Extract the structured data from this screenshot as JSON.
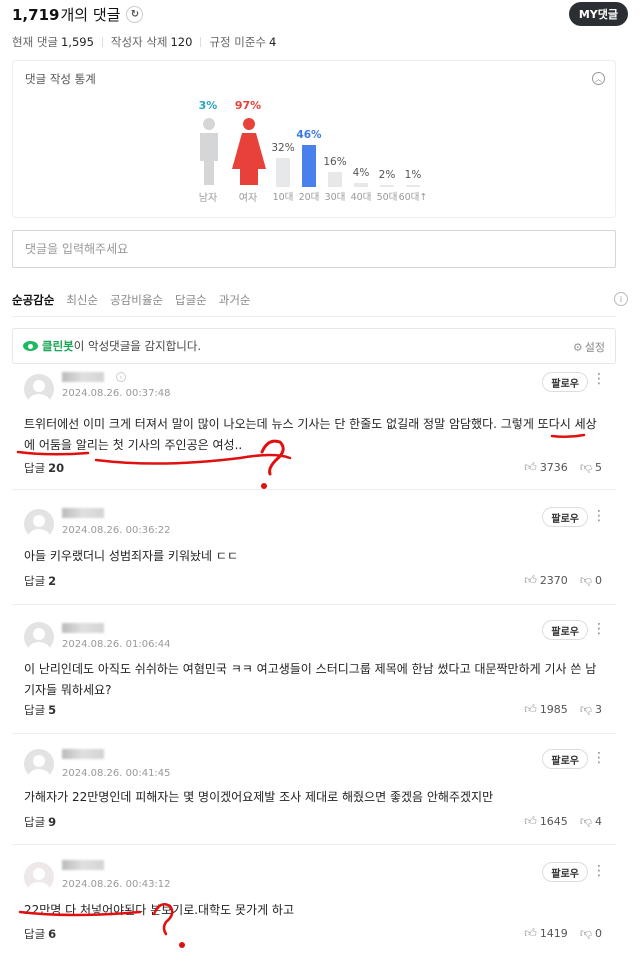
{
  "header": {
    "total_count": "1,719",
    "total_suffix": "개의 댓글",
    "my_comments_label": "MY댓글",
    "current_label": "현재 댓글",
    "current_value": "1,595",
    "deleted_label": "작성자 삭제",
    "deleted_value": "120",
    "violation_label": "규정 미준수",
    "violation_value": "4"
  },
  "stats": {
    "title": "댓글 작성 통계",
    "gender": [
      {
        "label": "남자",
        "percent": "3%",
        "value": 3,
        "color": "#2ba5bc"
      },
      {
        "label": "여자",
        "percent": "97%",
        "value": 97,
        "color": "#e8413a"
      }
    ],
    "age": [
      {
        "label": "10대",
        "percent": "32%",
        "value": 32
      },
      {
        "label": "20대",
        "percent": "46%",
        "value": 46
      },
      {
        "label": "30대",
        "percent": "16%",
        "value": 16
      },
      {
        "label": "40대",
        "percent": "4%",
        "value": 4
      },
      {
        "label": "50대",
        "percent": "2%",
        "value": 2
      },
      {
        "label": "60대↑",
        "percent": "1%",
        "value": 1
      }
    ]
  },
  "input": {
    "placeholder": "댓글을 입력해주세요"
  },
  "sort_tabs": [
    "순공감순",
    "최신순",
    "공감비율순",
    "답글순",
    "과거순"
  ],
  "cleanbot": {
    "name": "클린봇",
    "message": "이 악성댓글을 감지합니다.",
    "setting_label": "설정"
  },
  "comment_labels": {
    "follow": "팔로우",
    "reply": "답글"
  },
  "comments": [
    {
      "date": "2024.08.26. 00:37:48",
      "text": "트위터에선 이미 크게 터져서 말이 많이 나오는데 뉴스 기사는 단 한줄도 없길래 정말 암담했다. 그렇게 또다시 세상에 어둠을 알리는 첫 기사의 주인공은 여성..",
      "replies": "20",
      "likes": "3736",
      "dislikes": "5"
    },
    {
      "date": "2024.08.26. 00:36:22",
      "text": "아들 키우랬더니 성범죄자를 키워놨네 ㄷㄷ",
      "replies": "2",
      "likes": "2370",
      "dislikes": "0"
    },
    {
      "date": "2024.08.26. 01:06:44",
      "text": "이 난리인데도 아직도 쉬쉬하는 여혐민국 ㅋㅋ 여고생들이 스터디그룹 제목에 한남 썼다고 대문짝만하게 기사 쓴 남기자들 뭐하세요?",
      "replies": "5",
      "likes": "1985",
      "dislikes": "3"
    },
    {
      "date": "2024.08.26. 00:41:45",
      "text": "가해자가 22만명인데 피해자는 몇 명이겠어요제발 조사 제대로 해줬으면 좋겠음 안해주겠지만",
      "replies": "9",
      "likes": "1645",
      "dislikes": "4"
    },
    {
      "date": "2024.08.26. 00:43:12",
      "text": "22만명 다 처넣어야된다 본보기로.대학도 못가게 하고",
      "replies": "6",
      "likes": "1419",
      "dislikes": "0"
    }
  ]
}
